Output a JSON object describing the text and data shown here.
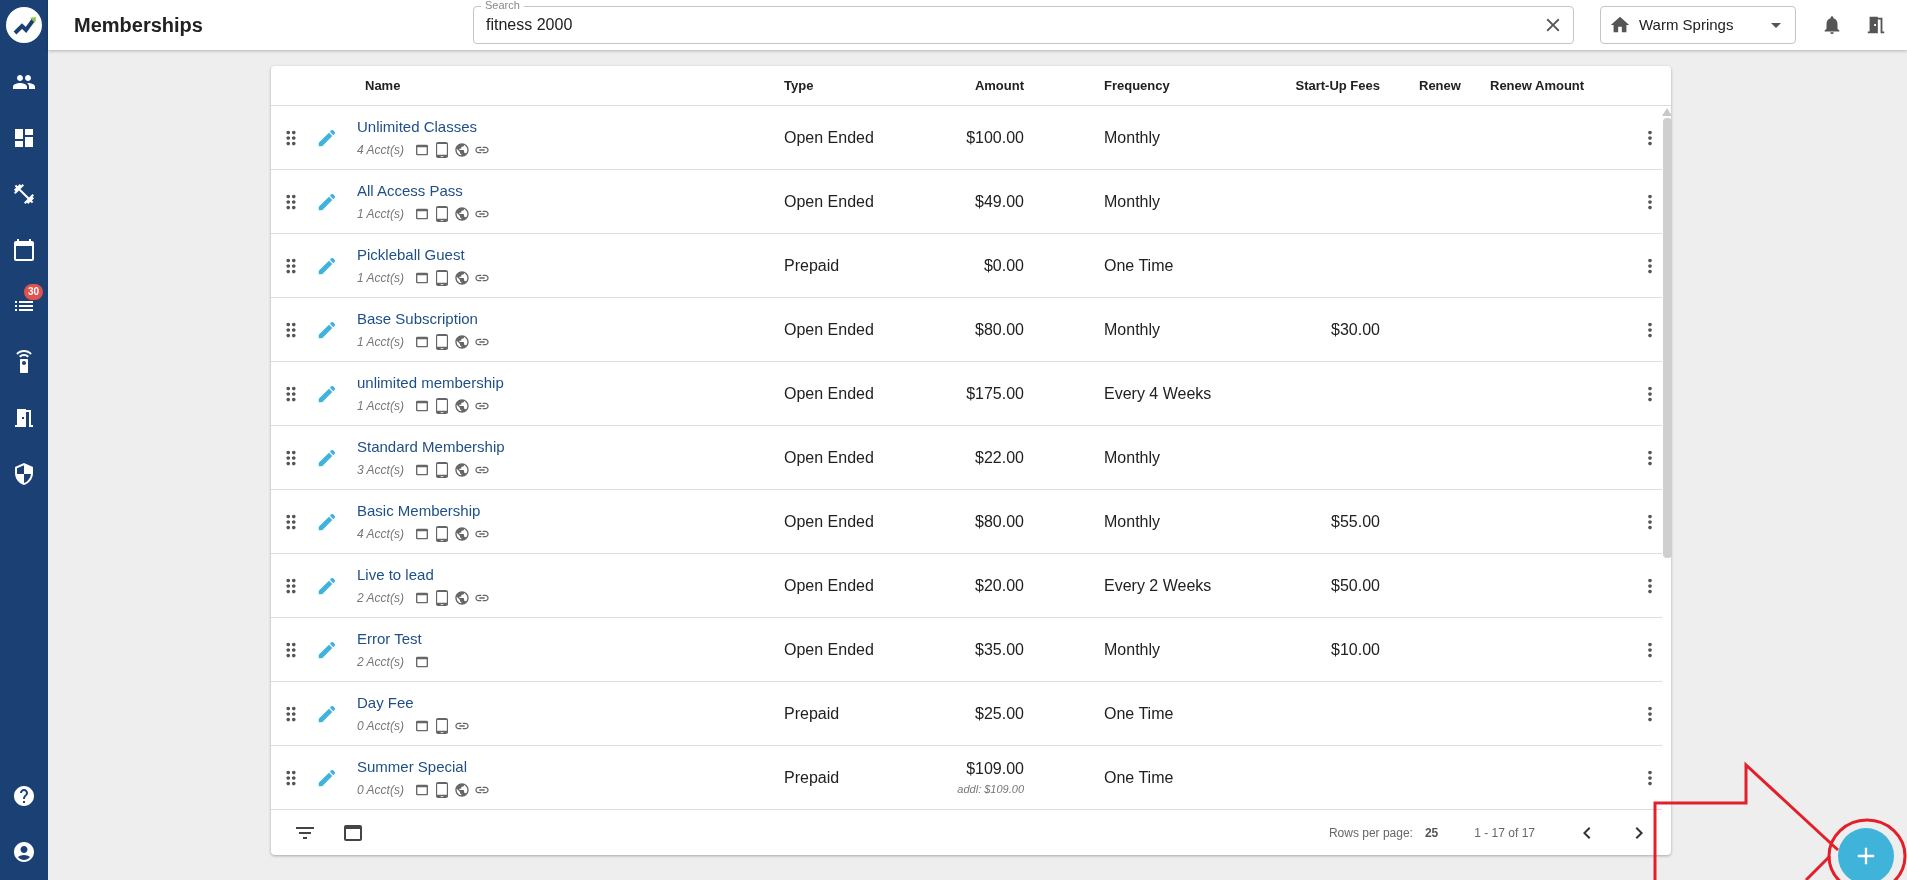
{
  "app_bar": {
    "title": "Memberships",
    "search": {
      "label": "Search",
      "value": "fitness 2000"
    },
    "location": "Warm Springs"
  },
  "sidebar": {
    "items": [
      {
        "kind": "people"
      },
      {
        "kind": "dashboard"
      },
      {
        "kind": "fitness"
      },
      {
        "kind": "calendar"
      },
      {
        "kind": "list",
        "badge": "30"
      },
      {
        "kind": "remote"
      },
      {
        "kind": "door"
      },
      {
        "kind": "shield"
      }
    ],
    "bottom_items": [
      {
        "kind": "help"
      },
      {
        "kind": "account"
      }
    ]
  },
  "table": {
    "columns": [
      "Name",
      "Type",
      "Amount",
      "Frequency",
      "Start-Up Fees",
      "Renew",
      "Renew Amount"
    ],
    "rows": [
      {
        "name": "Unlimited Classes",
        "accounts": "4 Acct(s)",
        "channels": [
          {
            "kind": "card"
          },
          {
            "kind": "tablet"
          },
          {
            "kind": "globe"
          },
          {
            "kind": "link"
          }
        ],
        "type": "Open Ended",
        "amount": "$100.00",
        "frequency": "Monthly"
      },
      {
        "name": "All Access Pass",
        "accounts": "1 Acct(s)",
        "channels": [
          {
            "kind": "card"
          },
          {
            "kind": "tablet"
          },
          {
            "kind": "globe"
          },
          {
            "kind": "link"
          }
        ],
        "type": "Open Ended",
        "amount": "$49.00",
        "frequency": "Monthly"
      },
      {
        "name": "Pickleball Guest",
        "accounts": "1 Acct(s)",
        "channels": [
          {
            "kind": "card"
          },
          {
            "kind": "tablet"
          },
          {
            "kind": "globe"
          },
          {
            "kind": "link"
          }
        ],
        "type": "Prepaid",
        "amount": "$0.00",
        "frequency": "One Time"
      },
      {
        "name": "Base Subscription",
        "accounts": "1 Acct(s)",
        "channels": [
          {
            "kind": "card"
          },
          {
            "kind": "tablet"
          },
          {
            "kind": "globe"
          },
          {
            "kind": "link"
          }
        ],
        "type": "Open Ended",
        "amount": "$80.00",
        "frequency": "Monthly",
        "startup_fees": "$30.00"
      },
      {
        "name": "unlimited membership",
        "accounts": "1 Acct(s)",
        "channels": [
          {
            "kind": "card"
          },
          {
            "kind": "tablet"
          },
          {
            "kind": "globe"
          },
          {
            "kind": "link"
          }
        ],
        "type": "Open Ended",
        "amount": "$175.00",
        "frequency": "Every 4 Weeks"
      },
      {
        "name": "Standard Membership",
        "accounts": "3 Acct(s)",
        "channels": [
          {
            "kind": "card"
          },
          {
            "kind": "tablet"
          },
          {
            "kind": "globe"
          },
          {
            "kind": "link"
          }
        ],
        "type": "Open Ended",
        "amount": "$22.00",
        "frequency": "Monthly"
      },
      {
        "name": "Basic Membership",
        "accounts": "4 Acct(s)",
        "channels": [
          {
            "kind": "card"
          },
          {
            "kind": "tablet"
          },
          {
            "kind": "globe"
          },
          {
            "kind": "link"
          }
        ],
        "type": "Open Ended",
        "amount": "$80.00",
        "frequency": "Monthly",
        "startup_fees": "$55.00"
      },
      {
        "name": "Live to lead",
        "accounts": "2 Acct(s)",
        "channels": [
          {
            "kind": "card"
          },
          {
            "kind": "tablet"
          },
          {
            "kind": "globe"
          },
          {
            "kind": "link"
          }
        ],
        "type": "Open Ended",
        "amount": "$20.00",
        "frequency": "Every 2 Weeks",
        "startup_fees": "$50.00"
      },
      {
        "name": "Error Test",
        "accounts": "2 Acct(s)",
        "channels": [
          {
            "kind": "card"
          }
        ],
        "type": "Open Ended",
        "amount": "$35.00",
        "frequency": "Monthly",
        "startup_fees": "$10.00"
      },
      {
        "name": "Day Fee",
        "accounts": "0 Acct(s)",
        "channels": [
          {
            "kind": "card"
          },
          {
            "kind": "tablet"
          },
          {
            "kind": "link"
          }
        ],
        "type": "Prepaid",
        "amount": "$25.00",
        "frequency": "One Time"
      },
      {
        "name": "Summer Special",
        "accounts": "0 Acct(s)",
        "channels": [
          {
            "kind": "card"
          },
          {
            "kind": "tablet"
          },
          {
            "kind": "globe"
          },
          {
            "kind": "link"
          }
        ],
        "type": "Prepaid",
        "amount": "$109.00",
        "amount_note": "addl: $109.00",
        "frequency": "One Time"
      }
    ]
  },
  "footer": {
    "rows_per_page_label": "Rows per page:",
    "rows_per_page": "25",
    "range": "1 - 17 of 17"
  },
  "annotation": {
    "kind": "arrow-circle",
    "color": "#e3202a"
  }
}
